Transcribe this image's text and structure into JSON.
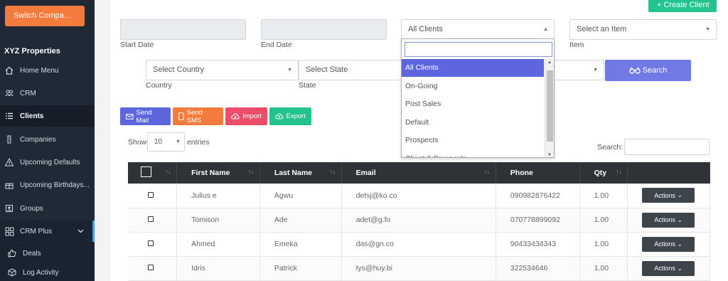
{
  "sidebar": {
    "switch_label": "Switch Compa...",
    "company": "XYZ Properties",
    "items": [
      {
        "label": "Home Menu"
      },
      {
        "label": "CRM"
      },
      {
        "label": "Clients"
      },
      {
        "label": "Companies"
      },
      {
        "label": "Upcoming Defaults"
      },
      {
        "label": "Upcoming Birthdays..."
      },
      {
        "label": "Groups"
      },
      {
        "label": "CRM Plus"
      },
      {
        "label": "Deals"
      },
      {
        "label": "Log Activity"
      }
    ]
  },
  "header": {
    "create_label": "+ Create Client"
  },
  "filters": {
    "start_date_label": "Start Date",
    "end_date_label": "End Date",
    "client_select": "All Clients",
    "item_select": "Select an Item",
    "item_label": "Item",
    "country_select": "Select Country",
    "country_label": "Country",
    "state_select": "Select State",
    "state_label": "State",
    "search_label": "Search"
  },
  "dropdown": {
    "options": [
      "All Clients",
      "On-Going",
      "Post Sales",
      "Default",
      "Prospects",
      "Client & Prospects"
    ],
    "selected": "All Clients"
  },
  "actions": {
    "send_mail": "Send Mail",
    "send_sms": "Send SMS",
    "import": "Import",
    "export": "Export"
  },
  "table_controls": {
    "show": "Show",
    "page_size": "10",
    "entries": "entries",
    "search": "Search:"
  },
  "table": {
    "columns": [
      "First Name",
      "Last Name",
      "Email",
      "Phone",
      "Qty"
    ],
    "action_label": "Actions",
    "rows": [
      {
        "first": "Julius e",
        "last": "Agwu",
        "email": "detsj@ko.co",
        "phone": "090982876422",
        "qty": "1.00"
      },
      {
        "first": "Tomison",
        "last": "Ade",
        "email": "adet@g.fo",
        "phone": "070778899092",
        "qty": "1.00"
      },
      {
        "first": "Ahmed",
        "last": "Emeka",
        "email": "das@gn.co",
        "phone": "90433434343",
        "qty": "1.00"
      },
      {
        "first": "Idris",
        "last": "Patrick",
        "email": "tys@huy.bi",
        "phone": "322534646",
        "qty": "1.00"
      }
    ]
  },
  "colors": {
    "sidebar": "#1f2a36",
    "accent": "#5d66dd",
    "orange": "#f47b3e",
    "green": "#22c38e",
    "red": "#ee4d6a"
  }
}
